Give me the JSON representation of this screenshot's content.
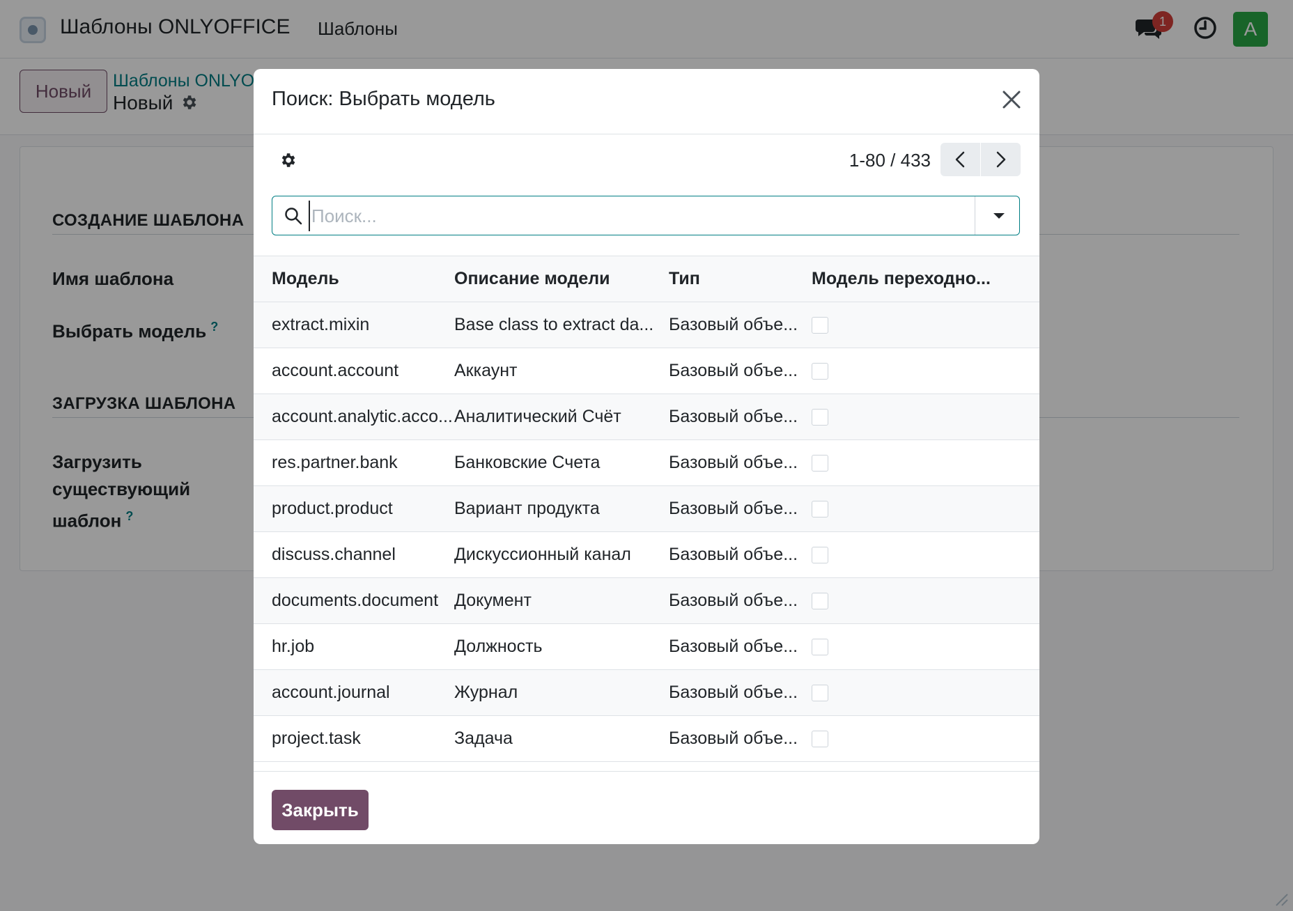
{
  "navbar": {
    "app_name": "Шаблоны ONLYOFFICE",
    "menu_item": "Шаблоны",
    "chat_badge": "1",
    "avatar_letter": "A"
  },
  "control_panel": {
    "new_button": "Новый",
    "breadcrumb_parent": "Шаблоны ONLYO",
    "breadcrumb_current": "Новый"
  },
  "form": {
    "section_create": "СОЗДАНИЕ ШАБЛОНА",
    "label_template_name": "Имя шаблона",
    "label_select_model": "Выбрать модель",
    "section_upload": "ЗАГРУЗКА ШАБЛОНА",
    "label_upload_line1": "Загрузить",
    "label_upload_line2": "существующий",
    "label_upload_line3": "шаблон",
    "help_mark": "?"
  },
  "modal": {
    "title": "Поиск: Выбрать модель",
    "pager_value": "1-80 / 433",
    "search_placeholder": "Поиск...",
    "columns": [
      "Модель",
      "Описание модели",
      "Тип",
      "Модель переходно..."
    ],
    "rows": [
      {
        "model": "extract.mixin",
        "description": "Base class to extract da...",
        "type": "Базовый объе...",
        "transient": false
      },
      {
        "model": "account.account",
        "description": "Аккаунт",
        "type": "Базовый объе...",
        "transient": false
      },
      {
        "model": "account.analytic.acco...",
        "description": "Аналитический Счёт",
        "type": "Базовый объе...",
        "transient": false
      },
      {
        "model": "res.partner.bank",
        "description": "Банковские Счета",
        "type": "Базовый объе...",
        "transient": false
      },
      {
        "model": "product.product",
        "description": "Вариант продукта",
        "type": "Базовый объе...",
        "transient": false
      },
      {
        "model": "discuss.channel",
        "description": "Дискуссионный канал",
        "type": "Базовый объе...",
        "transient": false
      },
      {
        "model": "documents.document",
        "description": "Документ",
        "type": "Базовый объе...",
        "transient": false
      },
      {
        "model": "hr.job",
        "description": "Должность",
        "type": "Базовый объе...",
        "transient": false
      },
      {
        "model": "account.journal",
        "description": "Журнал",
        "type": "Базовый объе...",
        "transient": false
      },
      {
        "model": "project.task",
        "description": "Задача",
        "type": "Базовый объе...",
        "transient": false
      }
    ],
    "close_button": "Закрыть"
  },
  "colors": {
    "primary": "#714b67",
    "accent": "#017e84",
    "badge": "#d23f3a",
    "avatar_bg": "#28a745"
  },
  "icons": [
    "app-logo-icon",
    "chat-icon",
    "clock-icon",
    "gear-icon",
    "close-icon",
    "chevron-left-icon",
    "chevron-right-icon",
    "search-icon",
    "caret-down-icon"
  ]
}
